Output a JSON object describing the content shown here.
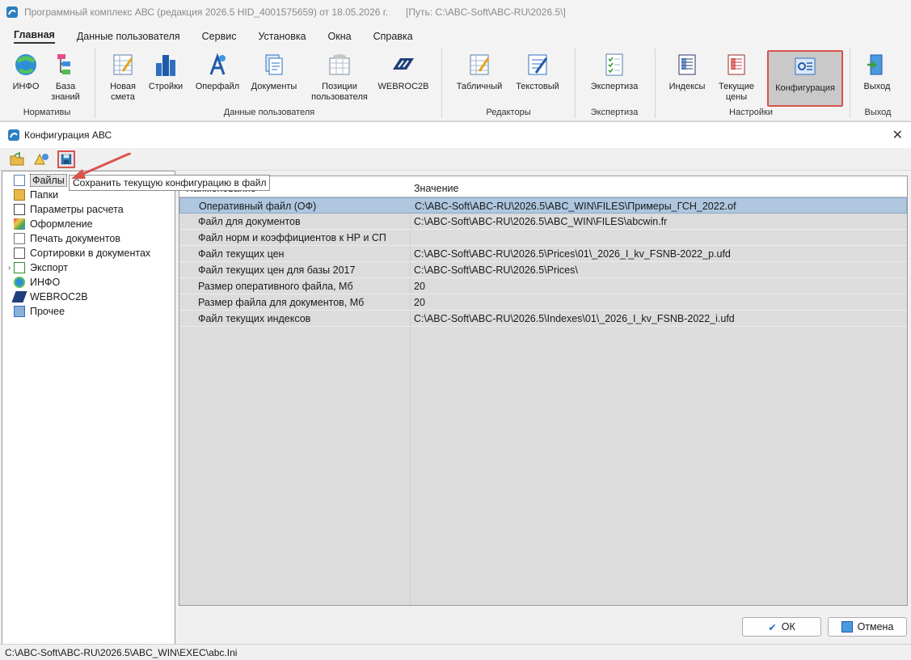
{
  "window": {
    "title": "Программный комплекс АВС (редакция 2026.5 HID_4001575659) от 18.05.2026 г.",
    "path": "[Путь: C:\\ABC-Soft\\ABC-RU\\2026.5\\]"
  },
  "menu": [
    "Главная",
    "Данные пользователя",
    "Сервис",
    "Установка",
    "Окна",
    "Справка"
  ],
  "ribbon": {
    "groups": [
      "Нормативы",
      "Данные пользователя",
      "Редакторы",
      "Экспертиза",
      "Настройки",
      "Выход"
    ],
    "buttons": {
      "info": "ИНФО",
      "kb": [
        "База",
        "знаний"
      ],
      "newest": [
        "Новая",
        "смета"
      ],
      "stroyki": "Стройки",
      "operfile": "Оперфайл",
      "docs": "Документы",
      "pos": [
        "Позиции",
        "пользователя"
      ],
      "webroc": "WEBROC2B",
      "table": "Табличный",
      "text": "Текстовый",
      "expert": "Экспертиза",
      "indexes": "Индексы",
      "prices": [
        "Текущие",
        "цены"
      ],
      "config": "Конфигурация",
      "exit": "Выход"
    }
  },
  "dialog": {
    "title": "Конфигурация АВС",
    "tooltip": "Сохранить текущую конфигурацию в файл",
    "tree": [
      "Файлы",
      "Папки",
      "Параметры расчета",
      "Оформление",
      "Печать документов",
      "Сортировки в документах",
      "Экспорт",
      "ИНФО",
      "WEBROC2B",
      "Прочее"
    ],
    "grid": {
      "col1_header": "Наименование",
      "col2_header": "Значение",
      "rows": [
        {
          "name": "Оперативный файл (ОФ)",
          "value": "C:\\ABC-Soft\\ABC-RU\\2026.5\\ABC_WIN\\FILES\\Примеры_ГСН_2022.of"
        },
        {
          "name": "Файл для документов",
          "value": "C:\\ABC-Soft\\ABC-RU\\2026.5\\ABC_WIN\\FILES\\abcwin.fr"
        },
        {
          "name": "Файл норм и коэффициентов к НР и СП",
          "value": ""
        },
        {
          "name": "Файл текущих цен",
          "value": "C:\\ABC-Soft\\ABC-RU\\2026.5\\Prices\\01\\_2026_I_kv_FSNB-2022_p.ufd"
        },
        {
          "name": "Файл текущих цен для базы 2017",
          "value": "C:\\ABC-Soft\\ABC-RU\\2026.5\\Prices\\"
        },
        {
          "name": "Размер оперативного файла, Мб",
          "value": "20"
        },
        {
          "name": "Размер файла для документов, Мб",
          "value": "20"
        },
        {
          "name": "Файл текущих индексов",
          "value": "C:\\ABC-Soft\\ABC-RU\\2026.5\\Indexes\\01\\_2026_I_kv_FSNB-2022_i.ufd"
        }
      ]
    },
    "ok_label": "ОК",
    "cancel_label": "Отмена",
    "status": "C:\\ABC-Soft\\ABC-RU\\2026.5\\ABC_WIN\\EXEC\\abc.Ini"
  }
}
